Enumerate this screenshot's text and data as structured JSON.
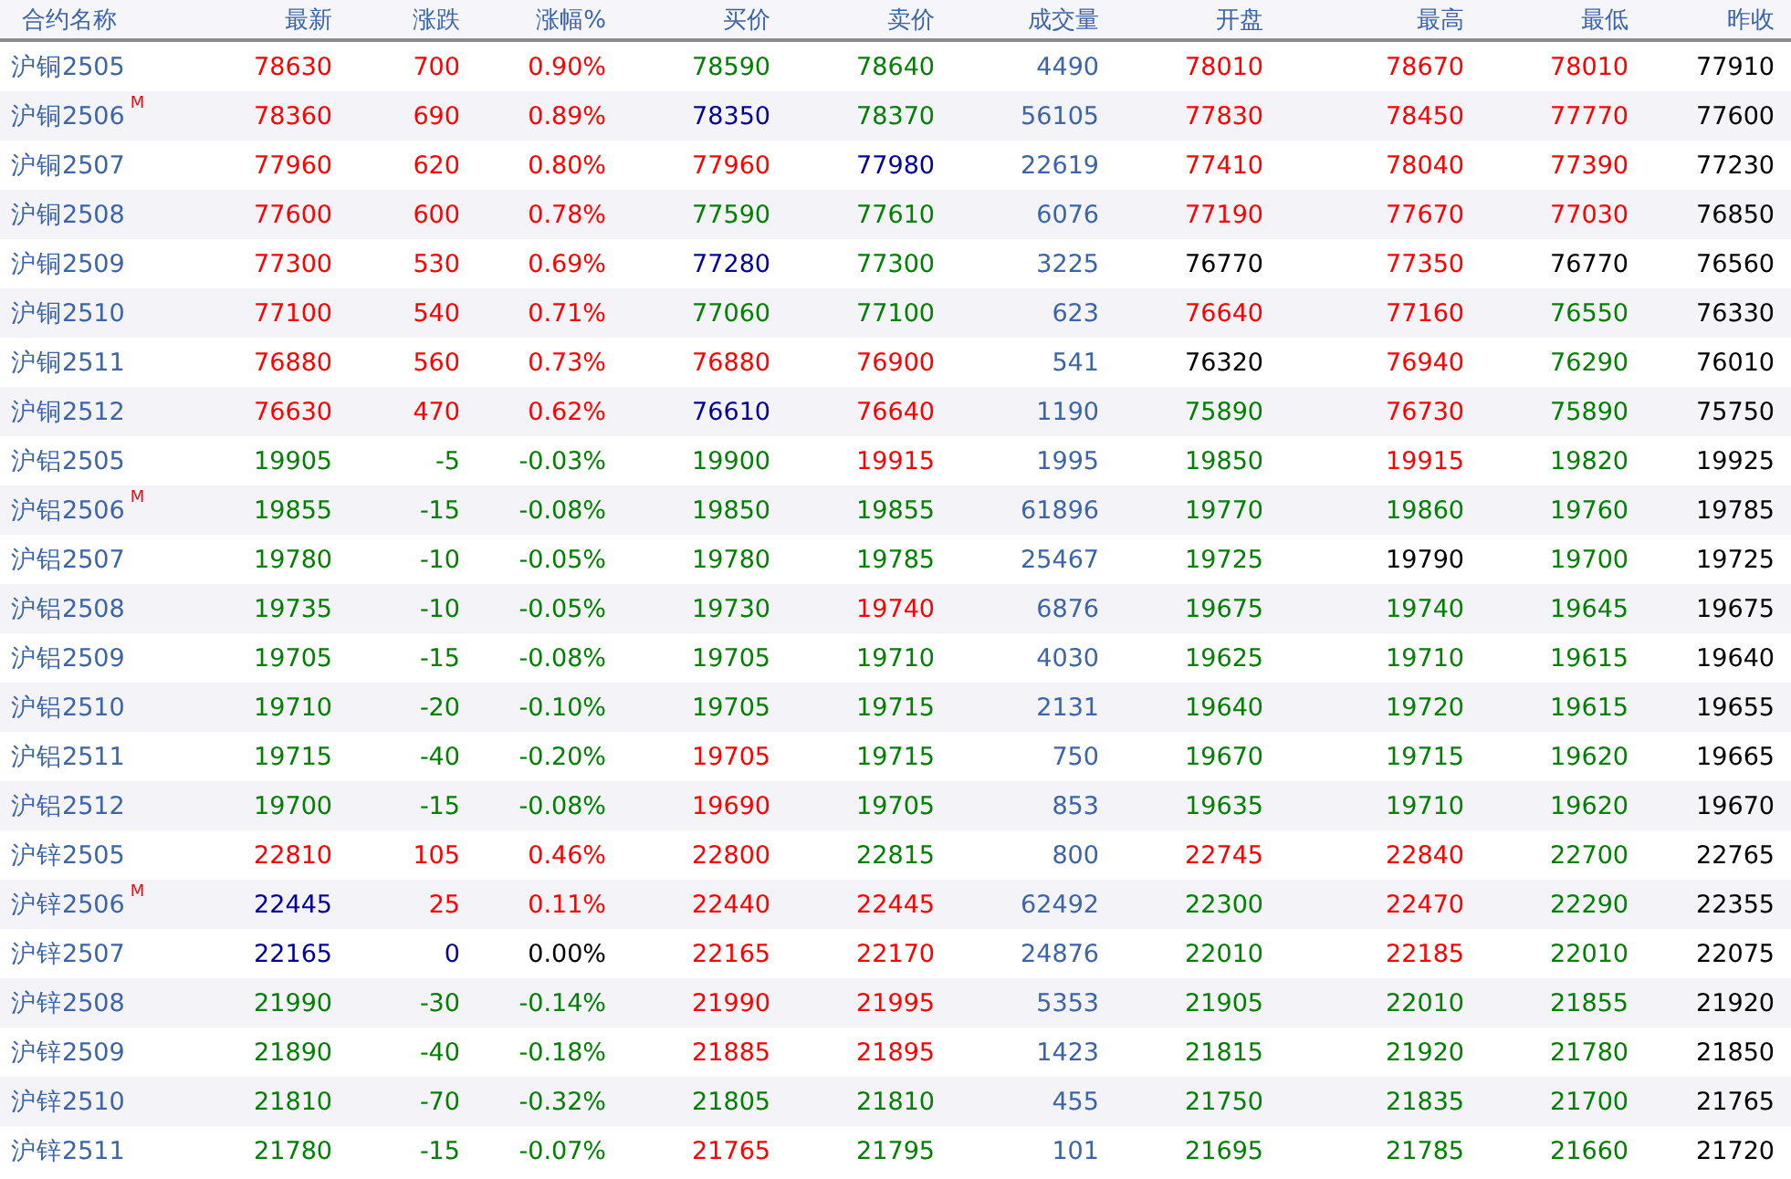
{
  "table": {
    "columns": [
      "合约名称",
      "最新",
      "涨跌",
      "涨幅%",
      "买价",
      "卖价",
      "成交量",
      "开盘",
      "最高",
      "最低",
      "昨收"
    ],
    "rows": [
      {
        "cells": [
          {
            "text": "沪铜2505"
          },
          {
            "text": "78630",
            "color": "#ff0000"
          },
          {
            "text": "700",
            "color": "#ff0000"
          },
          {
            "text": "0.90%",
            "color": "#ff0000"
          },
          {
            "text": "78590",
            "color": "#008000"
          },
          {
            "text": "78640",
            "color": "#008000"
          },
          {
            "text": "4490",
            "color": "#3c64a8"
          },
          {
            "text": "78010",
            "color": "#ff0000"
          },
          {
            "text": "78670",
            "color": "#ff0000"
          },
          {
            "text": "78010",
            "color": "#ff0000"
          },
          {
            "text": "77910",
            "color": "#000000"
          }
        ]
      },
      {
        "cells": [
          {
            "text": "沪铜2506",
            "badge": "M"
          },
          {
            "text": "78360",
            "color": "#ff0000"
          },
          {
            "text": "690",
            "color": "#ff0000"
          },
          {
            "text": "0.89%",
            "color": "#ff0000"
          },
          {
            "text": "78350",
            "color": "#000099"
          },
          {
            "text": "78370",
            "color": "#008000"
          },
          {
            "text": "56105",
            "color": "#3c64a8"
          },
          {
            "text": "77830",
            "color": "#ff0000"
          },
          {
            "text": "78450",
            "color": "#ff0000"
          },
          {
            "text": "77770",
            "color": "#ff0000"
          },
          {
            "text": "77600",
            "color": "#000000"
          }
        ]
      },
      {
        "cells": [
          {
            "text": "沪铜2507"
          },
          {
            "text": "77960",
            "color": "#ff0000"
          },
          {
            "text": "620",
            "color": "#ff0000"
          },
          {
            "text": "0.80%",
            "color": "#ff0000"
          },
          {
            "text": "77960",
            "color": "#ff0000"
          },
          {
            "text": "77980",
            "color": "#000099"
          },
          {
            "text": "22619",
            "color": "#3c64a8"
          },
          {
            "text": "77410",
            "color": "#ff0000"
          },
          {
            "text": "78040",
            "color": "#ff0000"
          },
          {
            "text": "77390",
            "color": "#ff0000"
          },
          {
            "text": "77230",
            "color": "#000000"
          }
        ]
      },
      {
        "cells": [
          {
            "text": "沪铜2508"
          },
          {
            "text": "77600",
            "color": "#ff0000"
          },
          {
            "text": "600",
            "color": "#ff0000"
          },
          {
            "text": "0.78%",
            "color": "#ff0000"
          },
          {
            "text": "77590",
            "color": "#008000"
          },
          {
            "text": "77610",
            "color": "#008000"
          },
          {
            "text": "6076",
            "color": "#3c64a8"
          },
          {
            "text": "77190",
            "color": "#ff0000"
          },
          {
            "text": "77670",
            "color": "#ff0000"
          },
          {
            "text": "77030",
            "color": "#ff0000"
          },
          {
            "text": "76850",
            "color": "#000000"
          }
        ]
      },
      {
        "cells": [
          {
            "text": "沪铜2509"
          },
          {
            "text": "77300",
            "color": "#ff0000"
          },
          {
            "text": "530",
            "color": "#ff0000"
          },
          {
            "text": "0.69%",
            "color": "#ff0000"
          },
          {
            "text": "77280",
            "color": "#000099"
          },
          {
            "text": "77300",
            "color": "#008000"
          },
          {
            "text": "3225",
            "color": "#3c64a8"
          },
          {
            "text": "76770",
            "color": "#000000"
          },
          {
            "text": "77350",
            "color": "#ff0000"
          },
          {
            "text": "76770",
            "color": "#000000"
          },
          {
            "text": "76560",
            "color": "#000000"
          }
        ]
      },
      {
        "cells": [
          {
            "text": "沪铜2510"
          },
          {
            "text": "77100",
            "color": "#ff0000"
          },
          {
            "text": "540",
            "color": "#ff0000"
          },
          {
            "text": "0.71%",
            "color": "#ff0000"
          },
          {
            "text": "77060",
            "color": "#008000"
          },
          {
            "text": "77100",
            "color": "#008000"
          },
          {
            "text": "623",
            "color": "#3c64a8"
          },
          {
            "text": "76640",
            "color": "#ff0000"
          },
          {
            "text": "77160",
            "color": "#ff0000"
          },
          {
            "text": "76550",
            "color": "#008000"
          },
          {
            "text": "76330",
            "color": "#000000"
          }
        ]
      },
      {
        "cells": [
          {
            "text": "沪铜2511"
          },
          {
            "text": "76880",
            "color": "#ff0000"
          },
          {
            "text": "560",
            "color": "#ff0000"
          },
          {
            "text": "0.73%",
            "color": "#ff0000"
          },
          {
            "text": "76880",
            "color": "#ff0000"
          },
          {
            "text": "76900",
            "color": "#ff0000"
          },
          {
            "text": "541",
            "color": "#3c64a8"
          },
          {
            "text": "76320",
            "color": "#000000"
          },
          {
            "text": "76940",
            "color": "#ff0000"
          },
          {
            "text": "76290",
            "color": "#008000"
          },
          {
            "text": "76010",
            "color": "#000000"
          }
        ]
      },
      {
        "cells": [
          {
            "text": "沪铜2512"
          },
          {
            "text": "76630",
            "color": "#ff0000"
          },
          {
            "text": "470",
            "color": "#ff0000"
          },
          {
            "text": "0.62%",
            "color": "#ff0000"
          },
          {
            "text": "76610",
            "color": "#000099"
          },
          {
            "text": "76640",
            "color": "#ff0000"
          },
          {
            "text": "1190",
            "color": "#3c64a8"
          },
          {
            "text": "75890",
            "color": "#008000"
          },
          {
            "text": "76730",
            "color": "#ff0000"
          },
          {
            "text": "75890",
            "color": "#008000"
          },
          {
            "text": "75750",
            "color": "#000000"
          }
        ]
      },
      {
        "cells": [
          {
            "text": "沪铝2505"
          },
          {
            "text": "19905",
            "color": "#008000"
          },
          {
            "text": "-5",
            "color": "#008000"
          },
          {
            "text": "-0.03%",
            "color": "#008000"
          },
          {
            "text": "19900",
            "color": "#008000"
          },
          {
            "text": "19915",
            "color": "#ff0000"
          },
          {
            "text": "1995",
            "color": "#3c64a8"
          },
          {
            "text": "19850",
            "color": "#008000"
          },
          {
            "text": "19915",
            "color": "#ff0000"
          },
          {
            "text": "19820",
            "color": "#008000"
          },
          {
            "text": "19925",
            "color": "#000000"
          }
        ]
      },
      {
        "cells": [
          {
            "text": "沪铝2506",
            "badge": "M"
          },
          {
            "text": "19855",
            "color": "#008000"
          },
          {
            "text": "-15",
            "color": "#008000"
          },
          {
            "text": "-0.08%",
            "color": "#008000"
          },
          {
            "text": "19850",
            "color": "#008000"
          },
          {
            "text": "19855",
            "color": "#008000"
          },
          {
            "text": "61896",
            "color": "#3c64a8"
          },
          {
            "text": "19770",
            "color": "#008000"
          },
          {
            "text": "19860",
            "color": "#008000"
          },
          {
            "text": "19760",
            "color": "#008000"
          },
          {
            "text": "19785",
            "color": "#000000"
          }
        ]
      },
      {
        "cells": [
          {
            "text": "沪铝2507"
          },
          {
            "text": "19780",
            "color": "#008000"
          },
          {
            "text": "-10",
            "color": "#008000"
          },
          {
            "text": "-0.05%",
            "color": "#008000"
          },
          {
            "text": "19780",
            "color": "#008000"
          },
          {
            "text": "19785",
            "color": "#008000"
          },
          {
            "text": "25467",
            "color": "#3c64a8"
          },
          {
            "text": "19725",
            "color": "#008000"
          },
          {
            "text": "19790",
            "color": "#000000"
          },
          {
            "text": "19700",
            "color": "#008000"
          },
          {
            "text": "19725",
            "color": "#000000"
          }
        ]
      },
      {
        "cells": [
          {
            "text": "沪铝2508"
          },
          {
            "text": "19735",
            "color": "#008000"
          },
          {
            "text": "-10",
            "color": "#008000"
          },
          {
            "text": "-0.05%",
            "color": "#008000"
          },
          {
            "text": "19730",
            "color": "#008000"
          },
          {
            "text": "19740",
            "color": "#ff0000"
          },
          {
            "text": "6876",
            "color": "#3c64a8"
          },
          {
            "text": "19675",
            "color": "#008000"
          },
          {
            "text": "19740",
            "color": "#008000"
          },
          {
            "text": "19645",
            "color": "#008000"
          },
          {
            "text": "19675",
            "color": "#000000"
          }
        ]
      },
      {
        "cells": [
          {
            "text": "沪铝2509"
          },
          {
            "text": "19705",
            "color": "#008000"
          },
          {
            "text": "-15",
            "color": "#008000"
          },
          {
            "text": "-0.08%",
            "color": "#008000"
          },
          {
            "text": "19705",
            "color": "#008000"
          },
          {
            "text": "19710",
            "color": "#008000"
          },
          {
            "text": "4030",
            "color": "#3c64a8"
          },
          {
            "text": "19625",
            "color": "#008000"
          },
          {
            "text": "19710",
            "color": "#008000"
          },
          {
            "text": "19615",
            "color": "#008000"
          },
          {
            "text": "19640",
            "color": "#000000"
          }
        ]
      },
      {
        "cells": [
          {
            "text": "沪铝2510"
          },
          {
            "text": "19710",
            "color": "#008000"
          },
          {
            "text": "-20",
            "color": "#008000"
          },
          {
            "text": "-0.10%",
            "color": "#008000"
          },
          {
            "text": "19705",
            "color": "#008000"
          },
          {
            "text": "19715",
            "color": "#008000"
          },
          {
            "text": "2131",
            "color": "#3c64a8"
          },
          {
            "text": "19640",
            "color": "#008000"
          },
          {
            "text": "19720",
            "color": "#008000"
          },
          {
            "text": "19615",
            "color": "#008000"
          },
          {
            "text": "19655",
            "color": "#000000"
          }
        ]
      },
      {
        "cells": [
          {
            "text": "沪铝2511"
          },
          {
            "text": "19715",
            "color": "#008000"
          },
          {
            "text": "-40",
            "color": "#008000"
          },
          {
            "text": "-0.20%",
            "color": "#008000"
          },
          {
            "text": "19705",
            "color": "#ff0000"
          },
          {
            "text": "19715",
            "color": "#008000"
          },
          {
            "text": "750",
            "color": "#3c64a8"
          },
          {
            "text": "19670",
            "color": "#008000"
          },
          {
            "text": "19715",
            "color": "#008000"
          },
          {
            "text": "19620",
            "color": "#008000"
          },
          {
            "text": "19665",
            "color": "#000000"
          }
        ]
      },
      {
        "cells": [
          {
            "text": "沪铝2512"
          },
          {
            "text": "19700",
            "color": "#008000"
          },
          {
            "text": "-15",
            "color": "#008000"
          },
          {
            "text": "-0.08%",
            "color": "#008000"
          },
          {
            "text": "19690",
            "color": "#ff0000"
          },
          {
            "text": "19705",
            "color": "#008000"
          },
          {
            "text": "853",
            "color": "#3c64a8"
          },
          {
            "text": "19635",
            "color": "#008000"
          },
          {
            "text": "19710",
            "color": "#008000"
          },
          {
            "text": "19620",
            "color": "#008000"
          },
          {
            "text": "19670",
            "color": "#000000"
          }
        ]
      },
      {
        "cells": [
          {
            "text": "沪锌2505"
          },
          {
            "text": "22810",
            "color": "#ff0000"
          },
          {
            "text": "105",
            "color": "#ff0000"
          },
          {
            "text": "0.46%",
            "color": "#ff0000"
          },
          {
            "text": "22800",
            "color": "#ff0000"
          },
          {
            "text": "22815",
            "color": "#008000"
          },
          {
            "text": "800",
            "color": "#3c64a8"
          },
          {
            "text": "22745",
            "color": "#ff0000"
          },
          {
            "text": "22840",
            "color": "#ff0000"
          },
          {
            "text": "22700",
            "color": "#008000"
          },
          {
            "text": "22765",
            "color": "#000000"
          }
        ]
      },
      {
        "cells": [
          {
            "text": "沪锌2506",
            "badge": "M"
          },
          {
            "text": "22445",
            "color": "#000099"
          },
          {
            "text": "25",
            "color": "#ff0000"
          },
          {
            "text": "0.11%",
            "color": "#ff0000"
          },
          {
            "text": "22440",
            "color": "#ff0000"
          },
          {
            "text": "22445",
            "color": "#ff0000"
          },
          {
            "text": "62492",
            "color": "#3c64a8"
          },
          {
            "text": "22300",
            "color": "#008000"
          },
          {
            "text": "22470",
            "color": "#ff0000"
          },
          {
            "text": "22290",
            "color": "#008000"
          },
          {
            "text": "22355",
            "color": "#000000"
          }
        ]
      },
      {
        "cells": [
          {
            "text": "沪锌2507"
          },
          {
            "text": "22165",
            "color": "#000099"
          },
          {
            "text": "0",
            "color": "#000099"
          },
          {
            "text": "0.00%",
            "color": "#000000"
          },
          {
            "text": "22165",
            "color": "#ff0000"
          },
          {
            "text": "22170",
            "color": "#ff0000"
          },
          {
            "text": "24876",
            "color": "#3c64a8"
          },
          {
            "text": "22010",
            "color": "#008000"
          },
          {
            "text": "22185",
            "color": "#ff0000"
          },
          {
            "text": "22010",
            "color": "#008000"
          },
          {
            "text": "22075",
            "color": "#000000"
          }
        ]
      },
      {
        "cells": [
          {
            "text": "沪锌2508"
          },
          {
            "text": "21990",
            "color": "#008000"
          },
          {
            "text": "-30",
            "color": "#008000"
          },
          {
            "text": "-0.14%",
            "color": "#008000"
          },
          {
            "text": "21990",
            "color": "#ff0000"
          },
          {
            "text": "21995",
            "color": "#ff0000"
          },
          {
            "text": "5353",
            "color": "#3c64a8"
          },
          {
            "text": "21905",
            "color": "#008000"
          },
          {
            "text": "22010",
            "color": "#008000"
          },
          {
            "text": "21855",
            "color": "#008000"
          },
          {
            "text": "21920",
            "color": "#000000"
          }
        ]
      },
      {
        "cells": [
          {
            "text": "沪锌2509"
          },
          {
            "text": "21890",
            "color": "#008000"
          },
          {
            "text": "-40",
            "color": "#008000"
          },
          {
            "text": "-0.18%",
            "color": "#008000"
          },
          {
            "text": "21885",
            "color": "#ff0000"
          },
          {
            "text": "21895",
            "color": "#ff0000"
          },
          {
            "text": "1423",
            "color": "#3c64a8"
          },
          {
            "text": "21815",
            "color": "#008000"
          },
          {
            "text": "21920",
            "color": "#008000"
          },
          {
            "text": "21780",
            "color": "#008000"
          },
          {
            "text": "21850",
            "color": "#000000"
          }
        ]
      },
      {
        "cells": [
          {
            "text": "沪锌2510"
          },
          {
            "text": "21810",
            "color": "#008000"
          },
          {
            "text": "-70",
            "color": "#008000"
          },
          {
            "text": "-0.32%",
            "color": "#008000"
          },
          {
            "text": "21805",
            "color": "#008000"
          },
          {
            "text": "21810",
            "color": "#008000"
          },
          {
            "text": "455",
            "color": "#3c64a8"
          },
          {
            "text": "21750",
            "color": "#008000"
          },
          {
            "text": "21835",
            "color": "#008000"
          },
          {
            "text": "21700",
            "color": "#008000"
          },
          {
            "text": "21765",
            "color": "#000000"
          }
        ]
      },
      {
        "cells": [
          {
            "text": "沪锌2511"
          },
          {
            "text": "21780",
            "color": "#008000"
          },
          {
            "text": "-15",
            "color": "#008000"
          },
          {
            "text": "-0.07%",
            "color": "#008000"
          },
          {
            "text": "21765",
            "color": "#ff0000"
          },
          {
            "text": "21795",
            "color": "#008000"
          },
          {
            "text": "101",
            "color": "#3c64a8"
          },
          {
            "text": "21695",
            "color": "#008000"
          },
          {
            "text": "21785",
            "color": "#008000"
          },
          {
            "text": "21660",
            "color": "#008000"
          },
          {
            "text": "21720",
            "color": "#000000"
          }
        ]
      }
    ]
  }
}
